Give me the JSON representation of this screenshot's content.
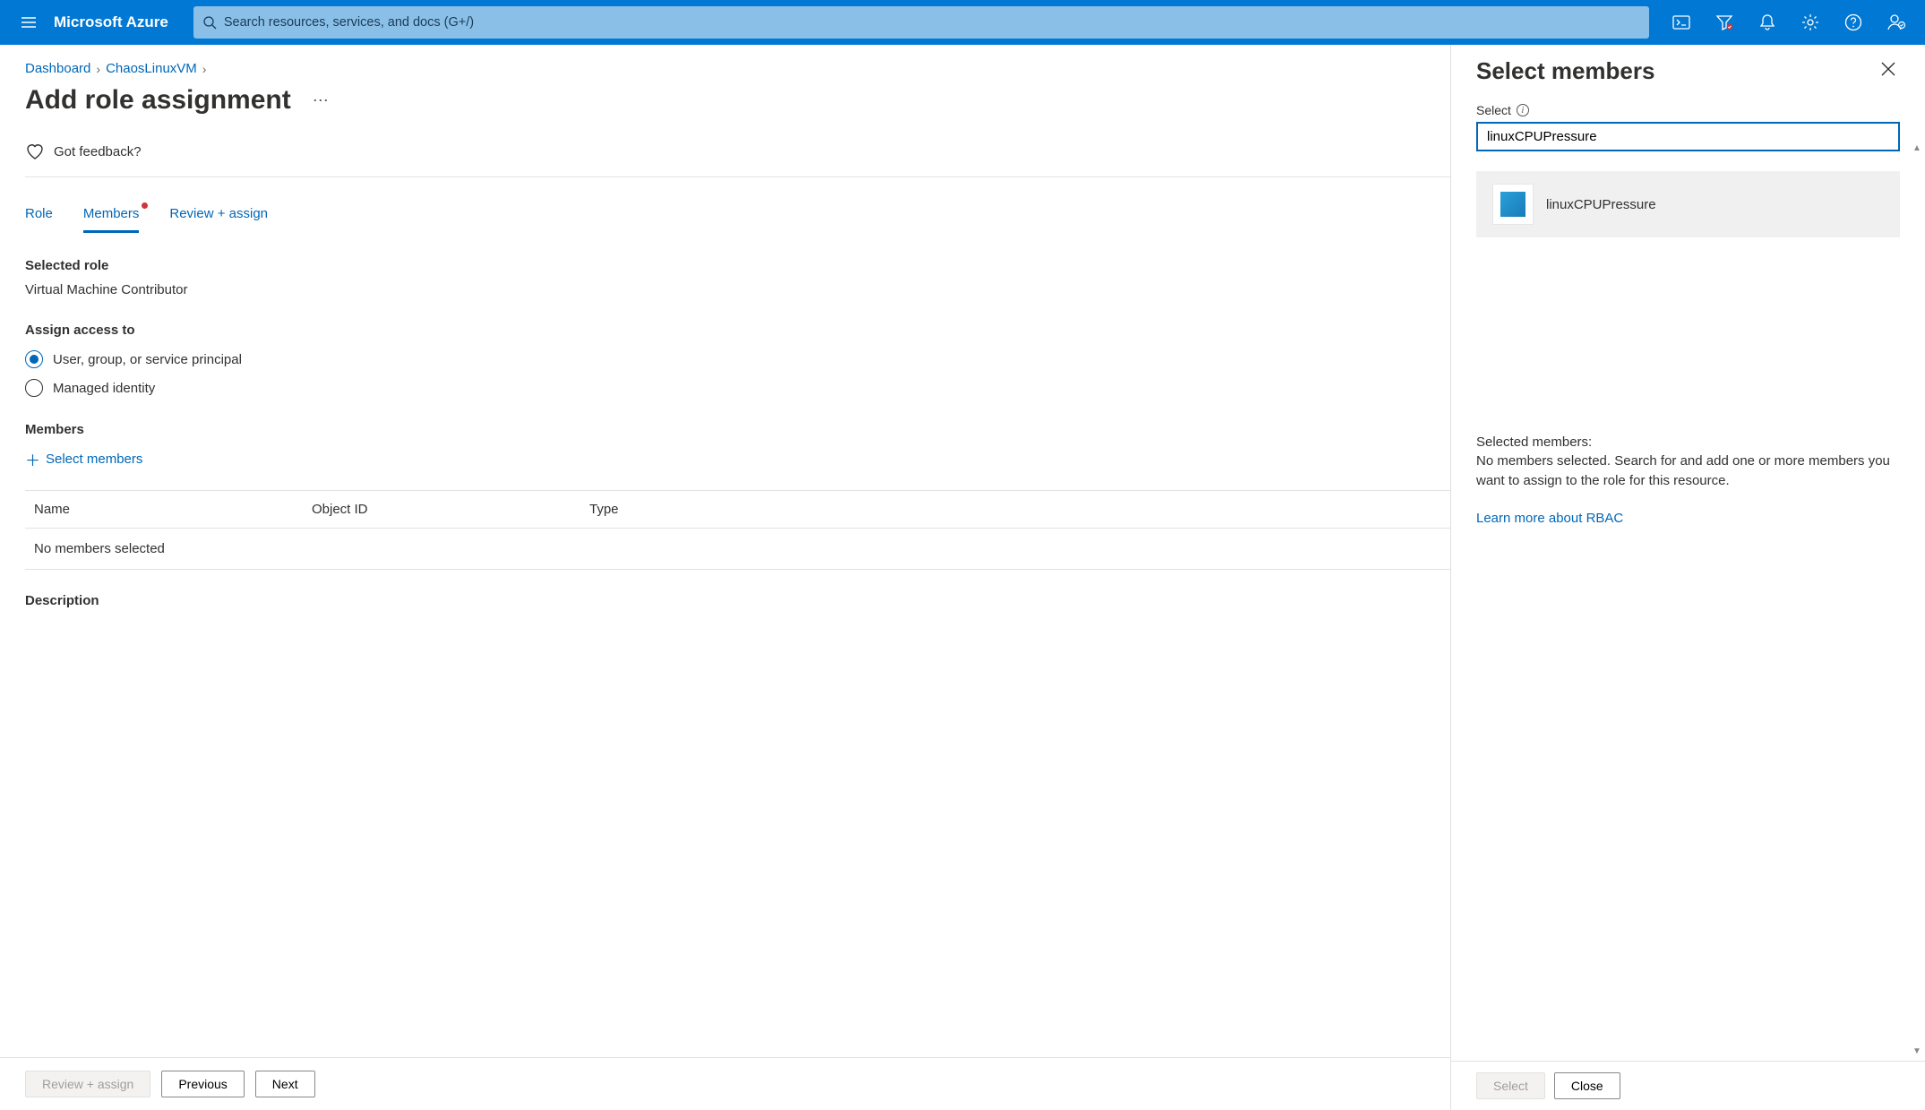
{
  "topbar": {
    "brand": "Microsoft Azure",
    "search_placeholder": "Search resources, services, and docs (G+/)"
  },
  "breadcrumb": {
    "items": [
      "Dashboard",
      "ChaosLinuxVM"
    ]
  },
  "page": {
    "title": "Add role assignment",
    "feedback": "Got feedback?"
  },
  "tabs": {
    "role": "Role",
    "members": "Members",
    "review": "Review + assign"
  },
  "selectedRole": {
    "label": "Selected role",
    "value": "Virtual Machine Contributor"
  },
  "assignAccess": {
    "label": "Assign access to",
    "opt1": "User, group, or service principal",
    "opt2": "Managed identity"
  },
  "members": {
    "label": "Members",
    "addLink": "Select members"
  },
  "table": {
    "headers": {
      "name": "Name",
      "objectId": "Object ID",
      "type": "Type"
    },
    "empty": "No members selected"
  },
  "description": {
    "label": "Description"
  },
  "mainFooter": {
    "review": "Review + assign",
    "previous": "Previous",
    "next": "Next"
  },
  "panel": {
    "title": "Select members",
    "fieldLabel": "Select",
    "searchValue": "linuxCPUPressure",
    "resultName": "linuxCPUPressure",
    "selectedHeader": "Selected members:",
    "selectedMsg": "No members selected. Search for and add one or more members you want to assign to the role for this resource.",
    "learnMore": "Learn more about RBAC",
    "selectBtn": "Select",
    "closeBtn": "Close"
  }
}
